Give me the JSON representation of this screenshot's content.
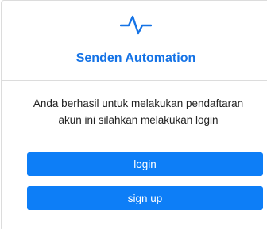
{
  "header": {
    "logo_icon": "activity-pulse-icon",
    "title": "Senden Automation"
  },
  "body": {
    "message": "Anda berhasil untuk melakukan pendaftaran akun ini silahkan melakukan login",
    "login_label": "login",
    "signup_label": "sign up"
  },
  "colors": {
    "brand": "#1573e6",
    "button": "#0d7ef7",
    "border": "#dcdcdc"
  }
}
